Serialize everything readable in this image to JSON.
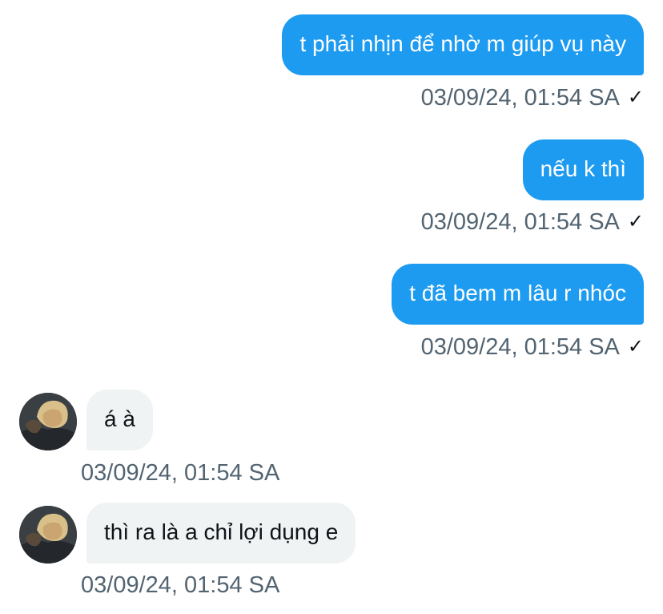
{
  "messages": [
    {
      "direction": "outgoing",
      "text": "t phải nhịn để nhờ m giúp vụ này",
      "timestamp": "03/09/24, 01:54 SA",
      "status_icon": "checkmark-icon",
      "status_glyph": "✓"
    },
    {
      "direction": "outgoing",
      "text": "nếu k thì",
      "timestamp": "03/09/24, 01:54 SA",
      "status_icon": "checkmark-icon",
      "status_glyph": "✓"
    },
    {
      "direction": "outgoing",
      "text": "t đã bem m lâu r nhóc",
      "timestamp": "03/09/24, 01:54 SA",
      "status_icon": "checkmark-icon",
      "status_glyph": "✓"
    },
    {
      "direction": "incoming",
      "text": "á à",
      "timestamp": "03/09/24, 01:54 SA",
      "avatar": "avatar-icon"
    },
    {
      "direction": "incoming",
      "text": "thì ra là a chỉ lợi dụng e",
      "timestamp": "03/09/24, 01:54 SA",
      "avatar": "avatar-icon"
    }
  ],
  "colors": {
    "outgoing_bubble": "#1d9bf0",
    "incoming_bubble": "#eff3f4",
    "timestamp_text": "#536471"
  }
}
